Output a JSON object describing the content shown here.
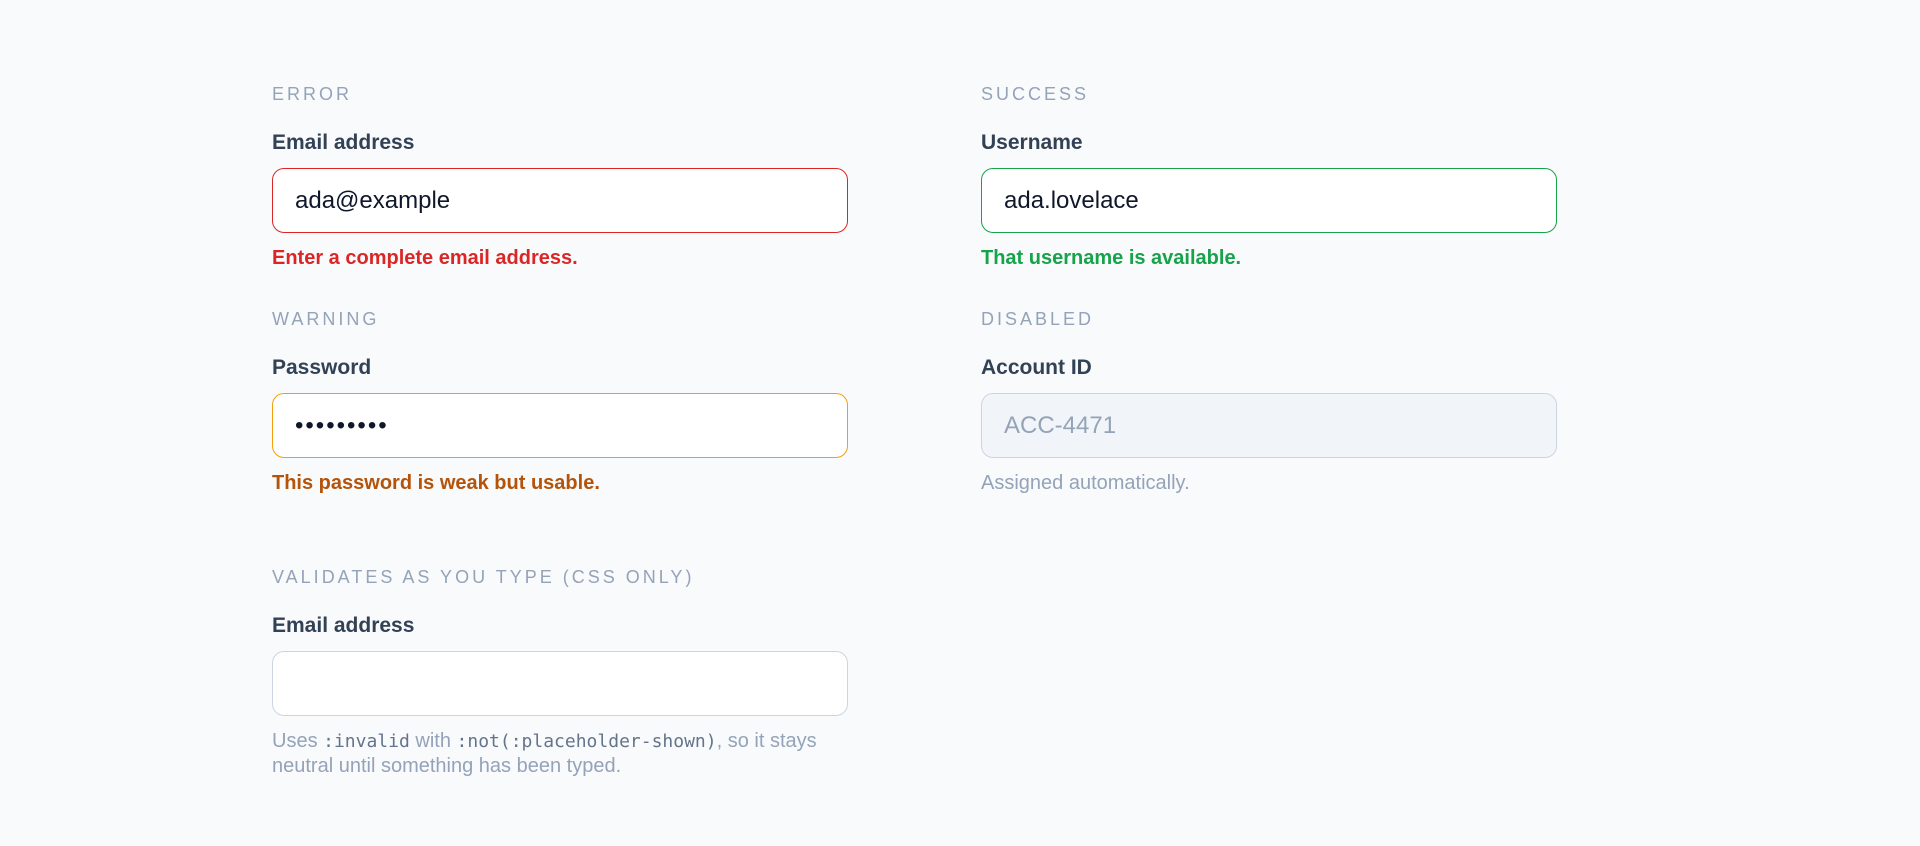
{
  "error_field": {
    "section": "ERROR",
    "label": "Email address",
    "value": "ada@example",
    "message": "Enter a complete email address."
  },
  "success_field": {
    "section": "SUCCESS",
    "label": "Username",
    "value": "ada.lovelace",
    "message": "That username is available."
  },
  "warning_field": {
    "section": "WARNING",
    "label": "Password",
    "value": "passw0rd1",
    "message": "This password is weak but usable."
  },
  "disabled_field": {
    "section": "DISABLED",
    "label": "Account ID",
    "value": "ACC-4471",
    "message": "Assigned automatically."
  },
  "live_field": {
    "section": "VALIDATES AS YOU TYPE (CSS ONLY)",
    "label": "Email address",
    "value": "",
    "hint": {
      "part1": "Uses ",
      "code1": ":invalid",
      "part2": " with ",
      "code2": ":not(:placeholder-shown)",
      "part3": ", so it stays neutral until something has been typed."
    }
  },
  "colors": {
    "error": "#dc2626",
    "warning": "#f59e0b",
    "success": "#16a34a",
    "muted": "#94a3b8"
  }
}
